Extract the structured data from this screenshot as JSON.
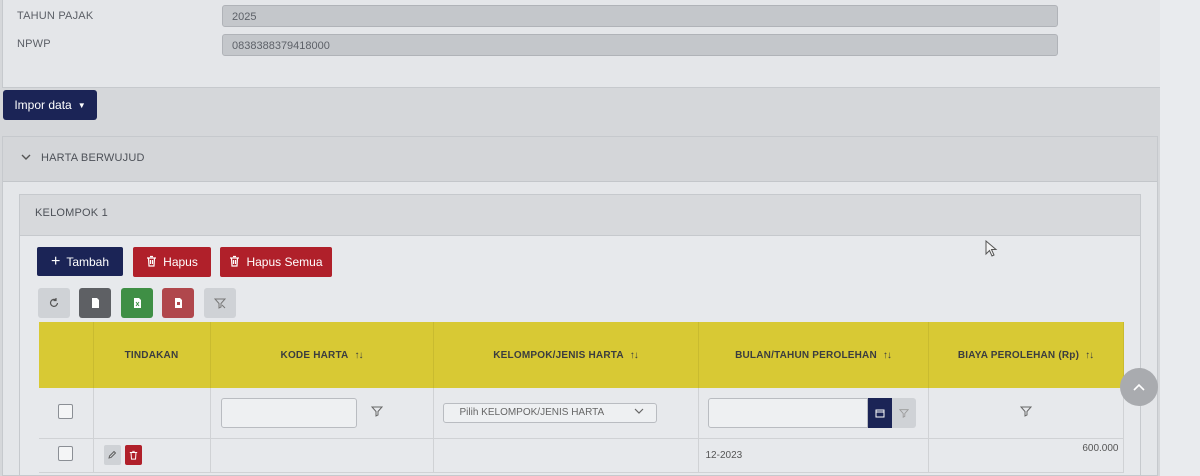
{
  "form": {
    "tahun_label": "TAHUN PAJAK",
    "tahun_value": "2025",
    "npwp_label": "NPWP",
    "npwp_value": "0838388379418000"
  },
  "import_button": "Impor data",
  "section": {
    "title": "HARTA BERWUJUD",
    "group_title": "KELOMPOK 1"
  },
  "toolbar": {
    "add": "Tambah",
    "delete": "Hapus",
    "delete_all": "Hapus Semua"
  },
  "table": {
    "columns": [
      "TINDAKAN",
      "KODE HARTA",
      "KELOMPOK/JENIS HARTA",
      "BULAN/TAHUN PEROLEHAN",
      "BIAYA PEROLEHAN (Rp)"
    ],
    "filter_select_placeholder": "Pilih KELOMPOK/JENIS HARTA",
    "rows": [
      {
        "kode": "",
        "kelompok": "",
        "bulan_tahun": "12-2023",
        "biaya": "600.000"
      }
    ]
  },
  "colors": {
    "primary": "#1b2456",
    "danger": "#b0202a",
    "header_yellow": "#d8c934",
    "success": "#3f8f45"
  }
}
